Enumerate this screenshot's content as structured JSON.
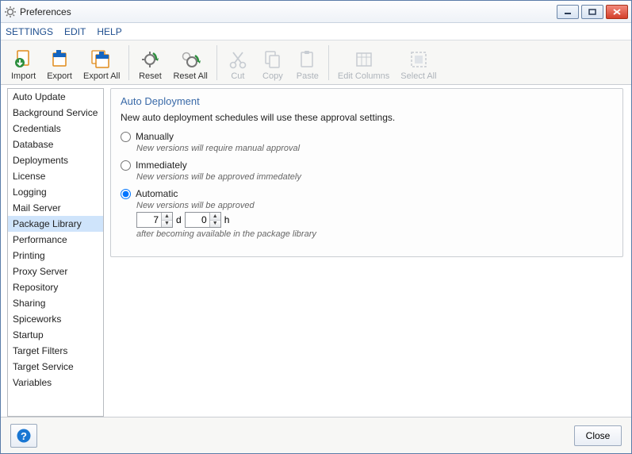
{
  "window": {
    "title": "Preferences"
  },
  "menu": {
    "settings": "SETTINGS",
    "edit": "EDIT",
    "help": "HELP"
  },
  "toolbar": {
    "import": "Import",
    "export": "Export",
    "export_all": "Export All",
    "reset": "Reset",
    "reset_all": "Reset All",
    "cut": "Cut",
    "copy": "Copy",
    "paste": "Paste",
    "edit_columns": "Edit Columns",
    "select_all": "Select All"
  },
  "sidebar": {
    "items": [
      {
        "label": "Auto Update"
      },
      {
        "label": "Background Service"
      },
      {
        "label": "Credentials"
      },
      {
        "label": "Database"
      },
      {
        "label": "Deployments"
      },
      {
        "label": "License"
      },
      {
        "label": "Logging"
      },
      {
        "label": "Mail Server"
      },
      {
        "label": "Package Library"
      },
      {
        "label": "Performance"
      },
      {
        "label": "Printing"
      },
      {
        "label": "Proxy Server"
      },
      {
        "label": "Repository"
      },
      {
        "label": "Sharing"
      },
      {
        "label": "Spiceworks"
      },
      {
        "label": "Startup"
      },
      {
        "label": "Target Filters"
      },
      {
        "label": "Target Service"
      },
      {
        "label": "Variables"
      }
    ],
    "selected_index": 8
  },
  "panel": {
    "title": "Auto Deployment",
    "desc": "New auto deployment schedules will use these approval settings.",
    "options": {
      "manually": {
        "label": "Manually",
        "note": "New versions will require manual approval"
      },
      "immediately": {
        "label": "Immediately",
        "note": "New versions will be approved immedately"
      },
      "automatic": {
        "label": "Automatic",
        "note": "New versions will be approved",
        "days": "7",
        "hours": "0",
        "d_label": "d",
        "h_label": "h",
        "after": "after becoming available in the package library"
      }
    },
    "selected": "automatic"
  },
  "footer": {
    "close": "Close"
  }
}
